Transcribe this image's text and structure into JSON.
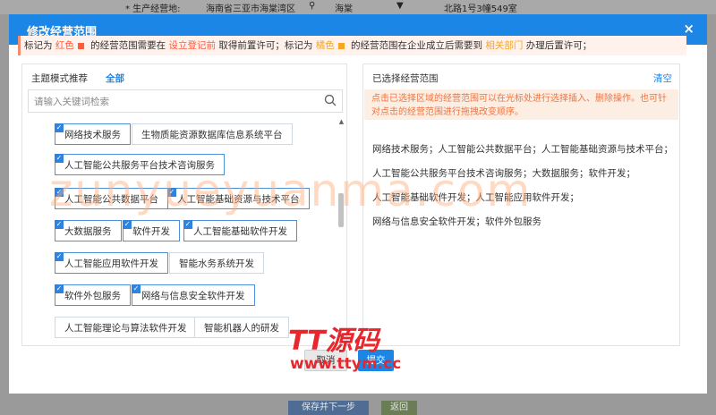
{
  "background_form": {
    "label": "* 生产经营地:",
    "location1": "海南省三亚市海棠湾区",
    "location2": "海棠",
    "address": "北路1号3幢549室",
    "save_next_label": "保存并下一步",
    "return_label": "返回"
  },
  "modal": {
    "title": "修改经营范围",
    "close_symbol": "×",
    "notice": {
      "p1": "标记为 ",
      "red_word": "红色",
      "p2": " 的经营范围需要在 ",
      "red_link": "设立登记前",
      "p3": " 取得前置许可；标记为 ",
      "orange_word": "橘色",
      "p4": " 的经营范围在企业成立后需要到 ",
      "orange_link": "相关部门",
      "p5": " 办理后置许可；"
    },
    "left_panel": {
      "title": "主题模式推荐",
      "all_label": "全部",
      "search_placeholder": "请输入关键词检索",
      "tags": [
        {
          "label": "网络技术服务",
          "selected": true
        },
        {
          "label": "生物质能资源数据库信息系统平台",
          "selected": false
        },
        {
          "label": "人工智能公共服务平台技术咨询服务",
          "selected": true
        },
        {
          "label": "人工智能公共数据平台",
          "selected": true
        },
        {
          "label": "人工智能基础资源与技术平台",
          "selected": true
        },
        {
          "label": "大数据服务",
          "selected": true
        },
        {
          "label": "软件开发",
          "selected": true
        },
        {
          "label": "人工智能基础软件开发",
          "selected": true
        },
        {
          "label": "人工智能应用软件开发",
          "selected": true
        },
        {
          "label": "智能水务系统开发",
          "selected": false
        },
        {
          "label": "软件外包服务",
          "selected": true
        },
        {
          "label": "网络与信息安全软件开发",
          "selected": true
        },
        {
          "label": "人工智能理论与算法软件开发",
          "selected": false
        },
        {
          "label": "智能机器人的研发",
          "selected": false
        }
      ]
    },
    "right_panel": {
      "title": "已选择经营范围",
      "clear_label": "清空",
      "hint": "点击已选择区域的经营范围可以在光标处进行选择插入、删除操作。也可针对点击的经营范围进行拖拽改变顺序。",
      "lines": [
        "网络技术服务；人工智能公共数据平台；人工智能基础资源与技术平台；",
        "人工智能公共服务平台技术咨询服务；大数据服务；软件开发；",
        "人工智能基础软件开发；人工智能应用软件开发；",
        "网络与信息安全软件开发；软件外包服务"
      ]
    },
    "cancel_label": "取消",
    "submit_label": "提交"
  },
  "watermark": {
    "text": "zunyueyuanma.com",
    "logo_text": "TT源码",
    "logo_url": "www.ttym.cc"
  },
  "colors": {
    "header": "#1c86e6",
    "red_mark": "#ff5a3c",
    "orange_mark": "#f5a623",
    "hint_text": "#f0743e"
  }
}
